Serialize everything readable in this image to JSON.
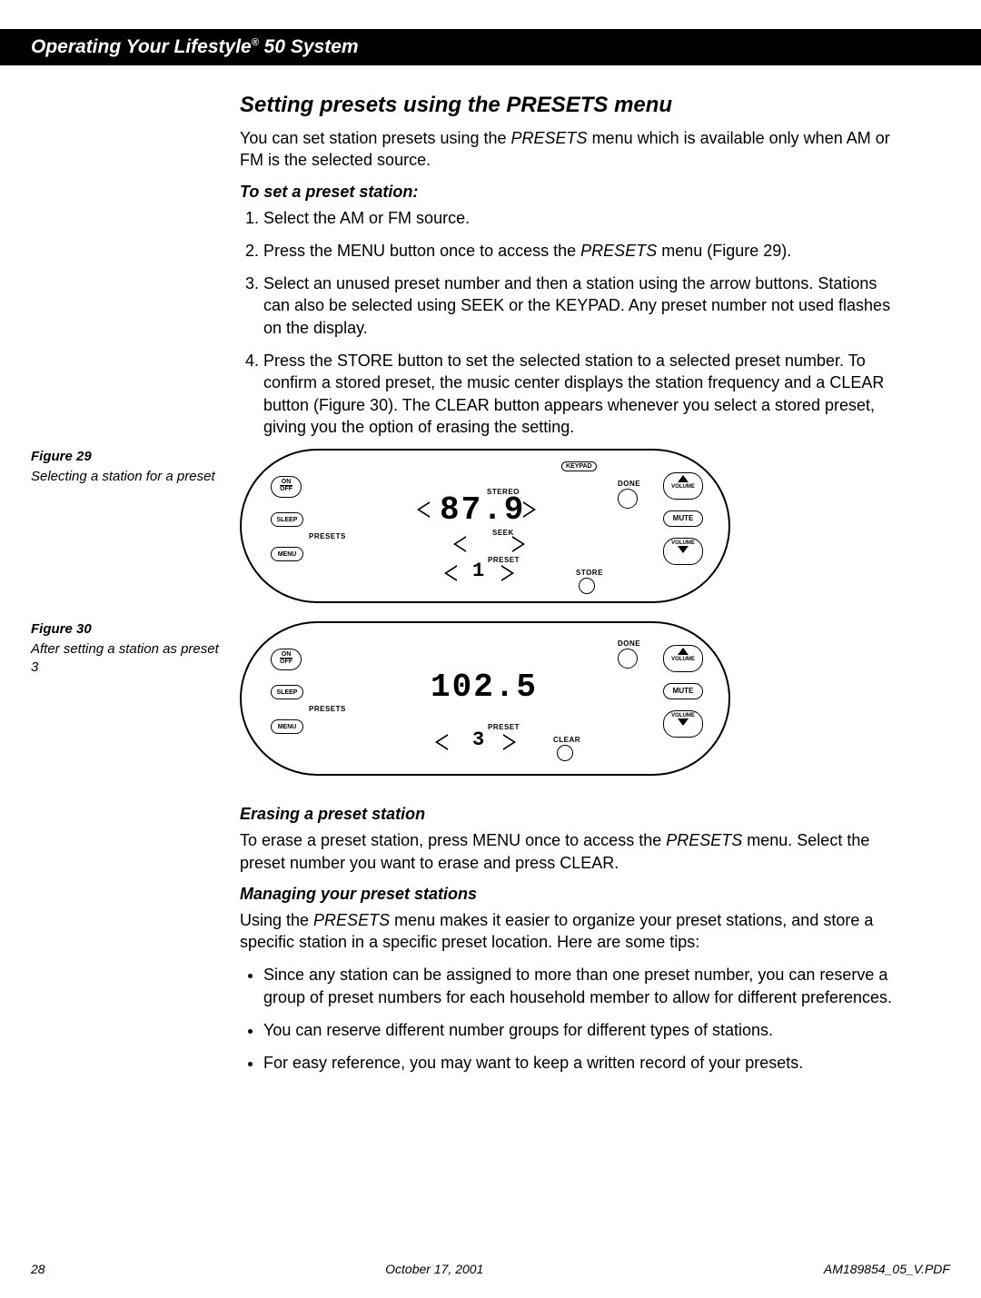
{
  "header": {
    "title_pre": "Operating Your Lifestyle",
    "title_reg": "®",
    "title_post": " 50 System"
  },
  "main": {
    "h1": "Setting presets using the PRESETS menu",
    "intro_plain_a": "You can set station presets using the ",
    "intro_em": "PRESETS",
    "intro_plain_b": " menu which is available only when AM or FM is the selected source.",
    "set_h2": "To set a preset station:",
    "steps": [
      "Select the AM or FM source.",
      "Press the MENU button once to access the PRESETS menu (Figure 29).",
      "Select an unused preset number and then a station using the arrow buttons. Stations can also be selected using SEEK or the KEYPAD. Any preset number not used flashes on the display.",
      "Press the STORE button to set the selected station to a selected preset number. To confirm a stored preset, the music center displays the station frequency and a CLEAR button (Figure 30). The CLEAR button appears whenever you select a stored preset, giving you the option of erasing the setting."
    ],
    "erase_h2": "Erasing a preset station",
    "erase_p_a": "To erase a preset station, press MENU once to access the ",
    "erase_p_em": "PRESETS",
    "erase_p_b": " menu. Select the preset number you want to erase and press CLEAR.",
    "manage_h2": "Managing your preset stations",
    "manage_p_a": "Using the ",
    "manage_p_em": "PRESETS",
    "manage_p_b": " menu makes it easier to organize your preset stations, and store a specific station in a specific preset location. Here are some tips:",
    "tips": [
      "Since any station can be assigned to more than one preset number, you can reserve a group of preset numbers for each household member to allow for different preferences.",
      "You can reserve different number groups for different types of stations.",
      "For easy reference, you may want to keep a written record of your presets."
    ]
  },
  "figures": {
    "f29": {
      "label": "Figure 29",
      "caption": "Selecting a station for a preset"
    },
    "f30": {
      "label": "Figure 30",
      "caption": "After setting a station as preset 3"
    }
  },
  "panel": {
    "keypad": "KEYPAD",
    "done": "DONE",
    "on": "ON",
    "off": "OFF",
    "sleep": "SLEEP",
    "menu": "MENU",
    "presets": "PRESETS",
    "stereo": "STEREO",
    "seek": "SEEK",
    "preset": "PRESET",
    "store": "STORE",
    "clear": "CLEAR",
    "volume": "VOLUME",
    "mute": "MUTE",
    "display29_freq": "87.9",
    "display29_preset": "1",
    "display30_freq": "102.5",
    "display30_preset": "3"
  },
  "footer": {
    "page": "28",
    "date": "October 17, 2001",
    "doc": "AM189854_05_V.PDF"
  }
}
